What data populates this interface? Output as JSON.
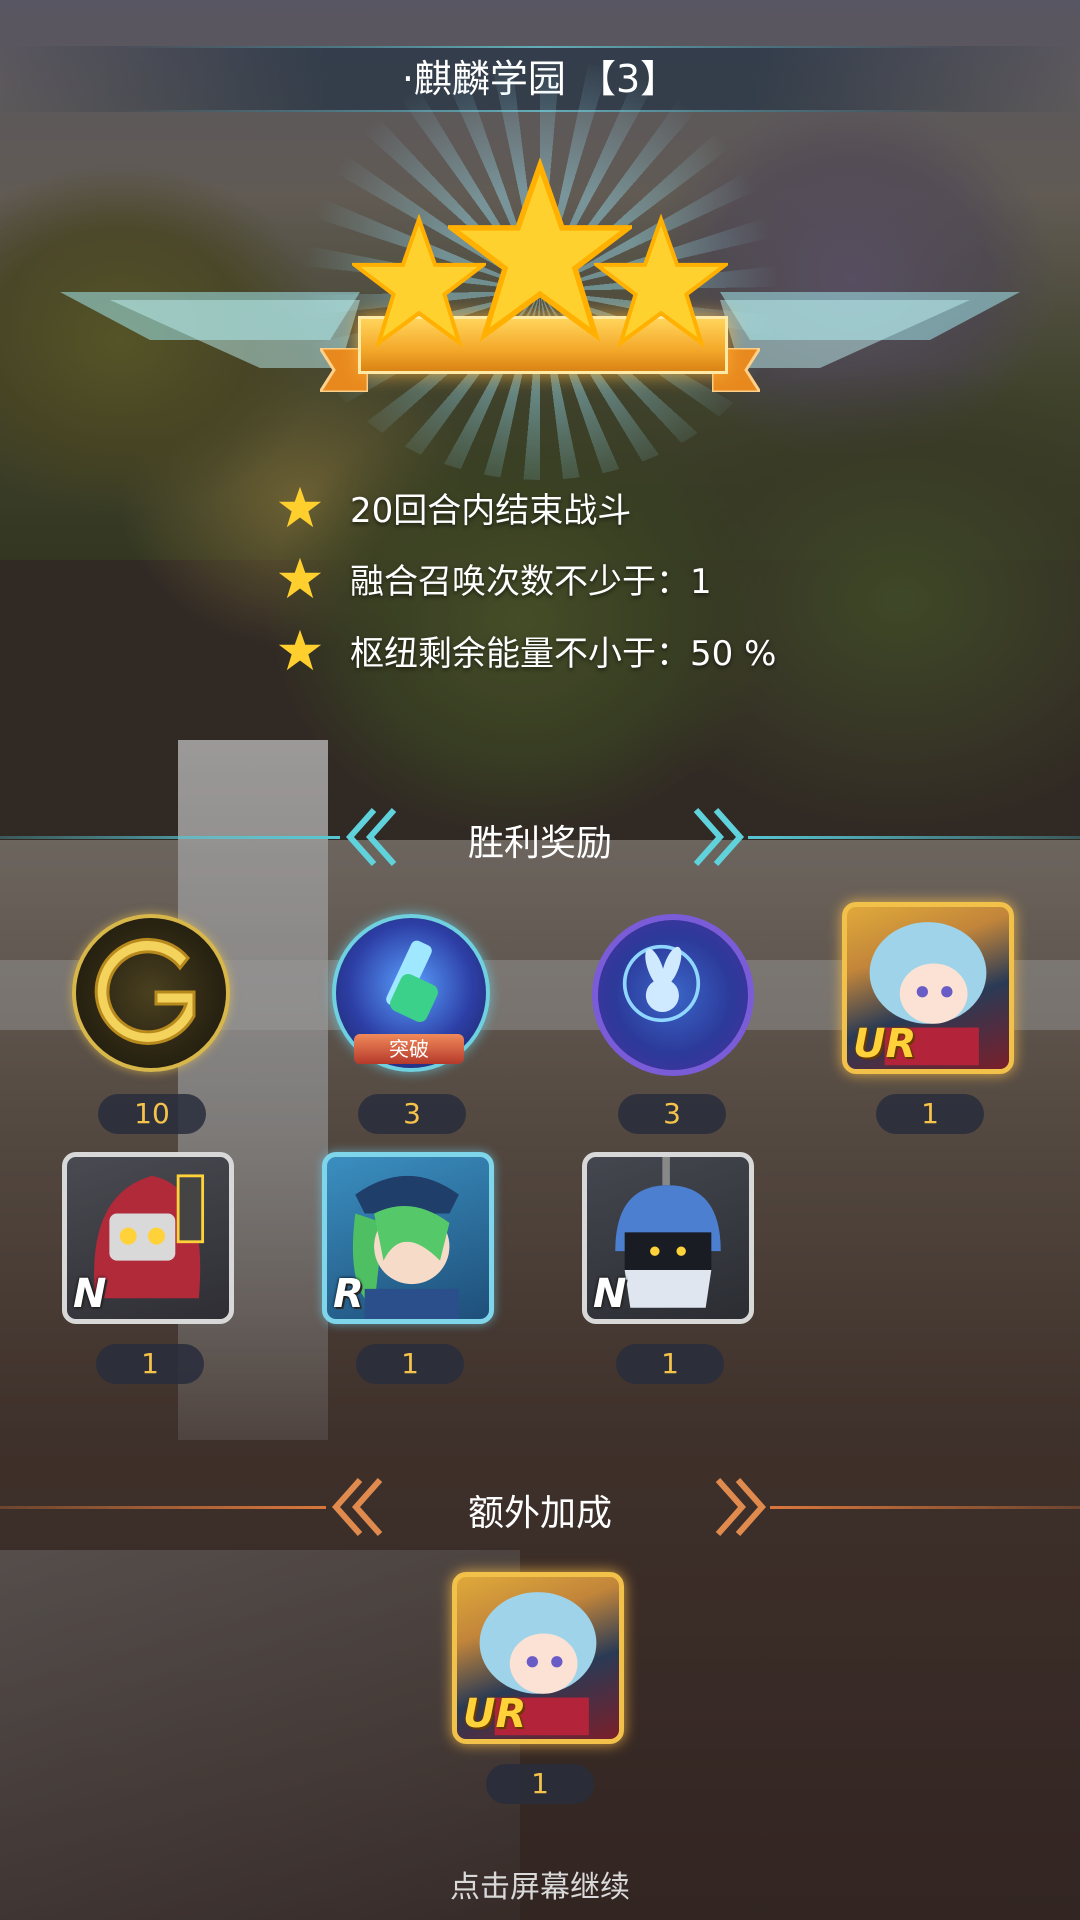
{
  "header": {
    "stage_title": "·麒麟学园 【3】",
    "stars_earned": 3,
    "stars_total": 3
  },
  "objectives": [
    {
      "icon": "star-icon",
      "text": "20回合内结束战斗"
    },
    {
      "icon": "star-icon",
      "text": "融合召唤次数不少于：1"
    },
    {
      "icon": "star-icon",
      "text": "枢纽剩余能量不小于：50 %"
    }
  ],
  "victory_rewards": {
    "title": "胜利奖励",
    "items": [
      {
        "icon": "gold-coin-icon",
        "quantity": "10"
      },
      {
        "icon": "breakthrough-item-icon",
        "badge": "突破",
        "quantity": "3"
      },
      {
        "icon": "rabbit-token-icon",
        "quantity": "3"
      },
      {
        "icon": "blue-hair-girl-card",
        "rarity": "UR",
        "quantity": "1"
      },
      {
        "icon": "red-hood-robot-card",
        "rarity": "N",
        "quantity": "1"
      },
      {
        "icon": "green-hair-captain-card",
        "rarity": "R",
        "quantity": "1"
      },
      {
        "icon": "blue-robot-card",
        "rarity": "N",
        "quantity": "1"
      }
    ]
  },
  "bonus": {
    "title": "额外加成",
    "items": [
      {
        "icon": "blue-hair-girl-card",
        "rarity": "UR",
        "quantity": "1"
      }
    ]
  },
  "footer": {
    "hint": "点击屏幕继续"
  },
  "colors": {
    "gold": "#f5c24a",
    "teal_line": "#57c7d4",
    "orange_line": "#d9773c",
    "star": "#ffcf2e"
  }
}
